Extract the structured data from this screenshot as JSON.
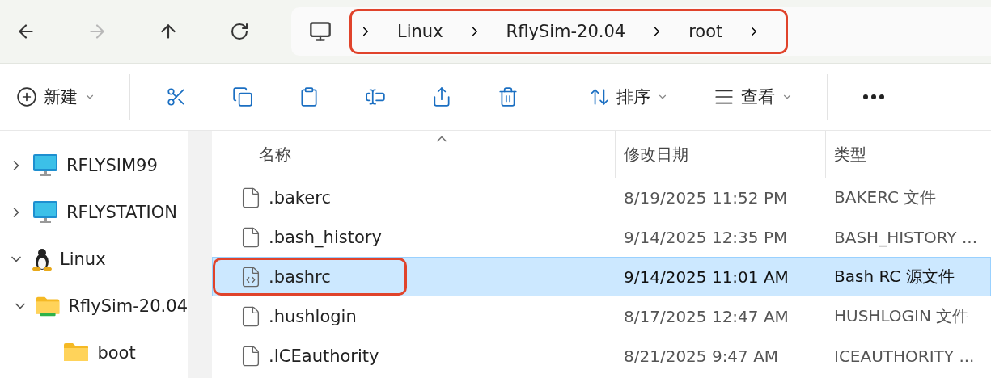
{
  "nav": {
    "back_disabled": false,
    "forward_disabled": true
  },
  "breadcrumb": {
    "highlighted": true,
    "items": [
      "Linux",
      "RflySim-20.04",
      "root"
    ]
  },
  "toolbar": [
    {
      "kind": "new",
      "label": "新建"
    },
    {
      "kind": "cut"
    },
    {
      "kind": "copy"
    },
    {
      "kind": "paste"
    },
    {
      "kind": "rename"
    },
    {
      "kind": "share"
    },
    {
      "kind": "delete"
    },
    {
      "kind": "sort",
      "label": "排序"
    },
    {
      "kind": "view",
      "label": "查看"
    },
    {
      "kind": "more"
    }
  ],
  "sidebar": {
    "items": [
      {
        "kind": "computer",
        "label": "RFLYSIM99",
        "expanded": false
      },
      {
        "kind": "computer",
        "label": "RFLYSTATION",
        "expanded": false
      },
      {
        "kind": "linux",
        "label": "Linux",
        "expanded": true,
        "children": [
          {
            "kind": "distro",
            "label": "RflySim-20.04",
            "expanded": true,
            "children": [
              {
                "kind": "folder",
                "label": "boot"
              }
            ]
          }
        ]
      }
    ]
  },
  "table": {
    "columns": [
      {
        "label": "名称",
        "sorted": true
      },
      {
        "label": "修改日期",
        "sorted": false
      },
      {
        "label": "类型",
        "sorted": false
      }
    ],
    "rows": [
      {
        "kind": "file",
        "name": ".bakerc",
        "date": "8/19/2025 11:52 PM",
        "type": "BAKERC 文件",
        "selected": false,
        "highlighted": false
      },
      {
        "kind": "file",
        "name": ".bash_history",
        "date": "9/14/2025 12:35 PM",
        "type": "BASH_HISTORY ...",
        "selected": false,
        "highlighted": false
      },
      {
        "kind": "script",
        "name": ".bashrc",
        "date": "9/14/2025 11:01 AM",
        "type": "Bash RC 源文件",
        "selected": true,
        "highlighted": true
      },
      {
        "kind": "file",
        "name": ".hushlogin",
        "date": "8/17/2025 12:47 AM",
        "type": "HUSHLOGIN 文件",
        "selected": false,
        "highlighted": false
      },
      {
        "kind": "file",
        "name": ".ICEauthority",
        "date": "8/21/2025 9:47 AM",
        "type": "ICEAUTHORITY ...",
        "selected": false,
        "highlighted": false
      }
    ]
  }
}
